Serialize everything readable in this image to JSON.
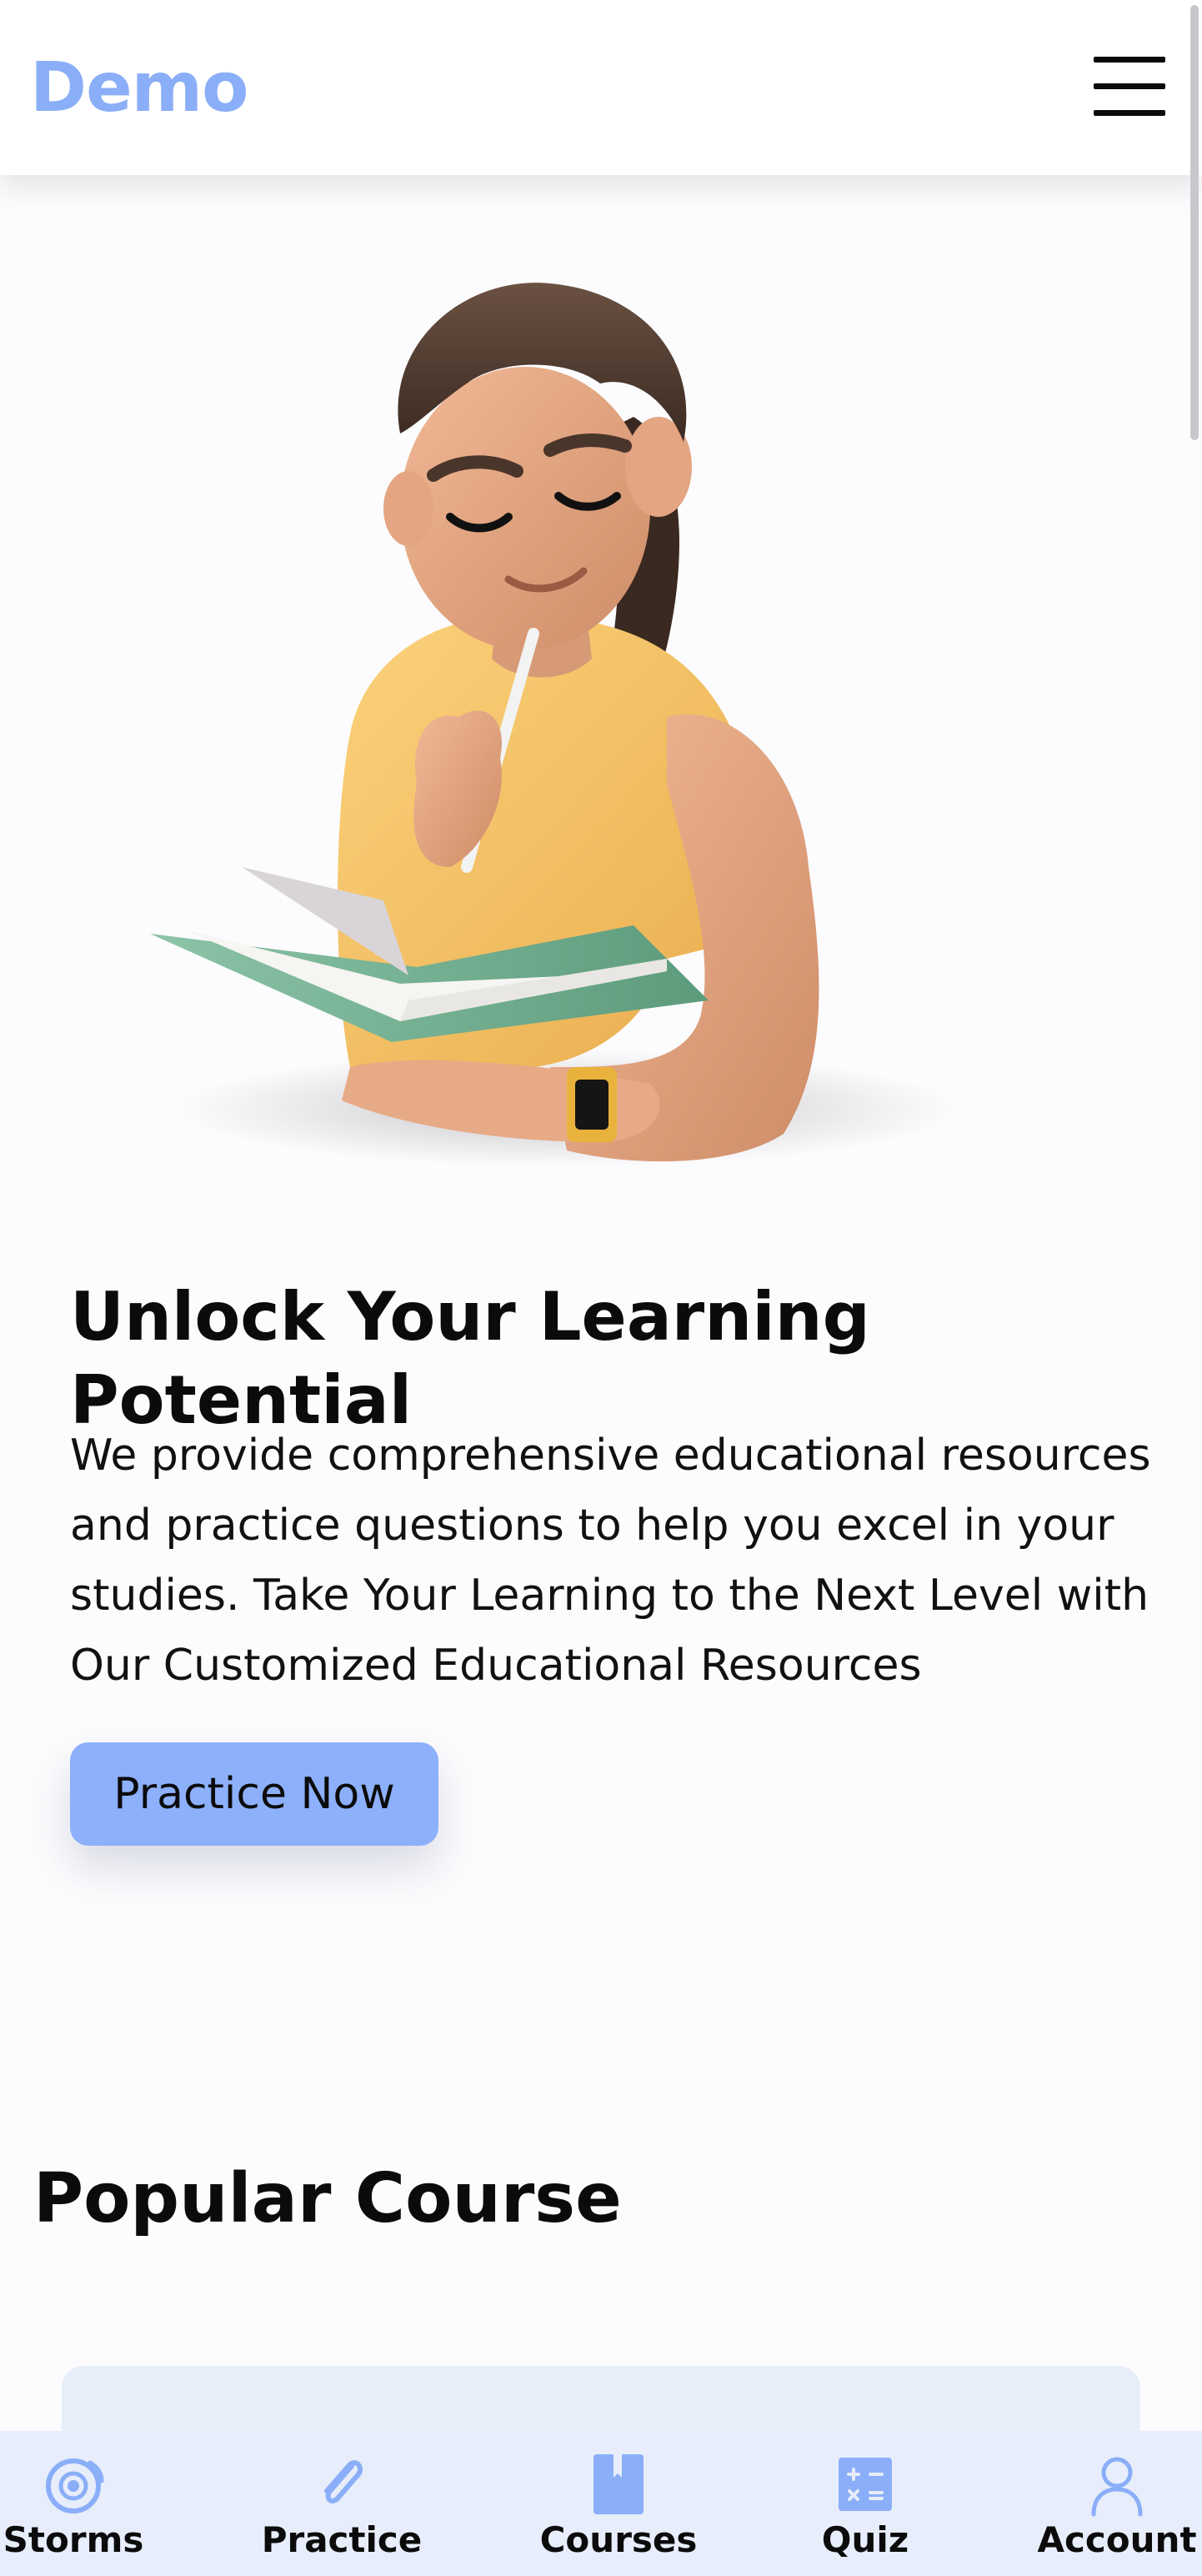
{
  "header": {
    "brand": "Demo",
    "menu_icon": "hamburger-menu-icon"
  },
  "hero": {
    "illustration": "student-reading-notebook-illustration",
    "title": "Unlock Your Learning Potential",
    "description": "We provide comprehensive educational resources and practice questions to help you excel in your studies. Take Your Learning to the Next Level with Our Customized Educational Resources",
    "cta_label": "Practice Now"
  },
  "popular": {
    "title": "Popular Course"
  },
  "bottom_nav": {
    "items": [
      {
        "label": "Storms",
        "icon": "target-ring-icon"
      },
      {
        "label": "Practice",
        "icon": "paperclip-icon"
      },
      {
        "label": "Courses",
        "icon": "book-icon"
      },
      {
        "label": "Quiz",
        "icon": "calculator-icon"
      },
      {
        "label": "Account",
        "icon": "user-icon"
      }
    ]
  },
  "colors": {
    "accent": "#8aaef8",
    "button": "#8db0fb",
    "nav_background": "#e7edfa",
    "icon": "#7fa4f5"
  }
}
